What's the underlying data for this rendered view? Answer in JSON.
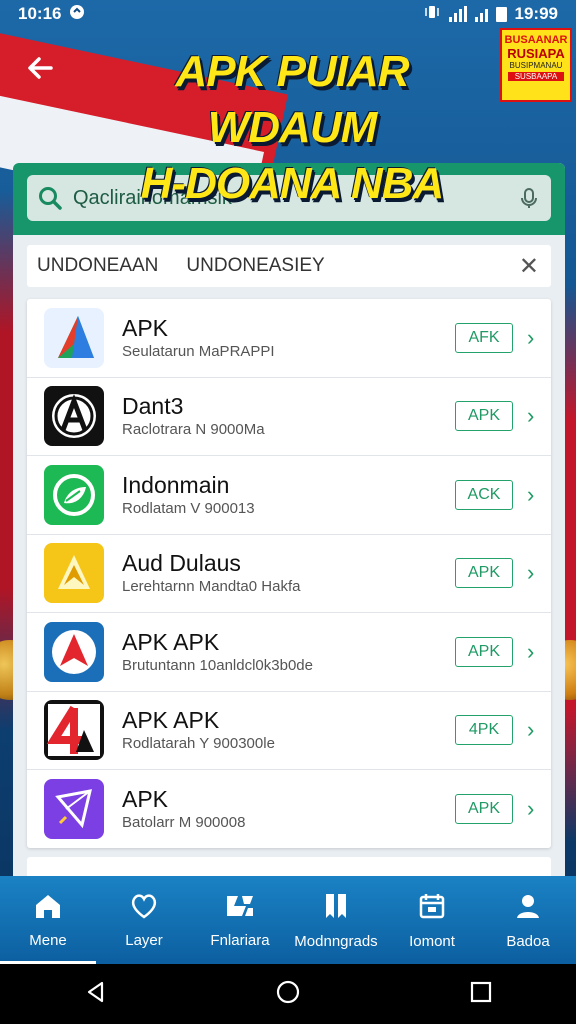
{
  "status_bar": {
    "time": "10:16",
    "time_right": "19:99"
  },
  "header": {
    "title_line1": "APK PUIAR WDAUM",
    "title_line2": "H-DOANA NBA",
    "promo": {
      "line1": "BUSAANAR",
      "line2": "RUSIAPA",
      "line3": "BUSIPMANAU",
      "line4": "SUSBAAPA"
    }
  },
  "search": {
    "value": "Qacliraihomamsik"
  },
  "filters": {
    "chip1": "UNDONEAAN",
    "chip2": "UNDONEASIEY"
  },
  "apps": [
    {
      "name": "APK",
      "subtitle": "Seulatarun MaPRAPPI",
      "button": "AFK",
      "icon": "triangle-app-icon"
    },
    {
      "name": "Dant3",
      "subtitle": "Raclotrara N 9000Ma",
      "button": "APK",
      "icon": "letter-a-app-icon"
    },
    {
      "name": "Indonmain",
      "subtitle": "Rodlatam V 900013",
      "button": "ACK",
      "icon": "green-leaf-app-icon"
    },
    {
      "name": "Aud Dulaus",
      "subtitle": "Lerehtarnn Mandta0 Hakfa",
      "button": "APK",
      "icon": "yellow-star-app-icon"
    },
    {
      "name": "APK APK",
      "subtitle": "Brutuntann 10anldcl0k3b0de",
      "button": "APK",
      "icon": "red-arrow-app-icon"
    },
    {
      "name": "APK APK",
      "subtitle": "Rodlatarah Y 900300le",
      "button": "4PK",
      "icon": "number-4-app-icon"
    },
    {
      "name": "APK",
      "subtitle": "Batolarr M 900008",
      "button": "APK",
      "icon": "purple-kite-app-icon"
    }
  ],
  "bottom_nav": [
    {
      "label": "Mene",
      "icon": "home-icon",
      "active": true
    },
    {
      "label": "Layer",
      "icon": "heart-outline-icon"
    },
    {
      "label": "Fnlariara",
      "icon": "puzzle-icon"
    },
    {
      "label": "Modnngrads",
      "icon": "bookmarks-icon"
    },
    {
      "label": "Iomont",
      "icon": "calendar-icon"
    },
    {
      "label": "Badoa",
      "icon": "profile-icon"
    }
  ],
  "colors": {
    "accent": "#17966b",
    "title": "#ffe617",
    "nav": "#1a82c4"
  }
}
